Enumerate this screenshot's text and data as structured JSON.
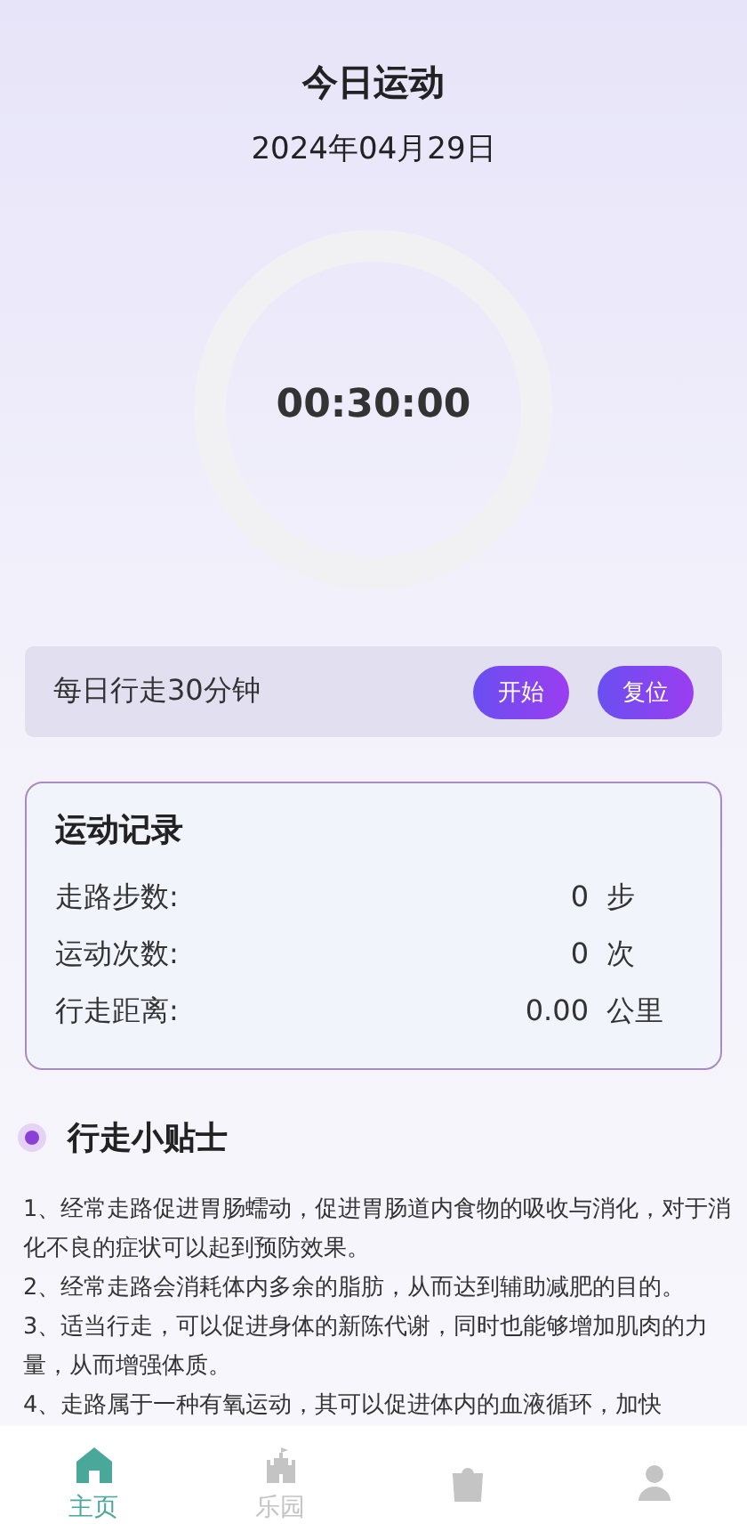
{
  "header": {
    "title": "今日运动",
    "date": "2024年04月29日"
  },
  "timer": {
    "time": "00:30:00"
  },
  "task": {
    "label": "每日行走30分钟",
    "buttons": [
      "开始",
      "复位"
    ]
  },
  "record": {
    "title": "运动记录",
    "rows": [
      {
        "label": "走路步数:",
        "value": "0",
        "unit": "步"
      },
      {
        "label": "运动次数:",
        "value": "0",
        "unit": "次"
      },
      {
        "label": "行走距离:",
        "value": "0.00",
        "unit": "公里"
      }
    ]
  },
  "tips": {
    "title": "行走小贴士",
    "items": [
      "1、经常走路促进胃肠蠕动，促进胃肠道内食物的吸收与消化，对于消化不良的症状可以起到预防效果。",
      "2、经常走路会消耗体内多余的脂肪，从而达到辅助减肥的目的。",
      "3、适当行走，可以促进身体的新陈代谢，同时也能够增加肌肉的力量，从而增强体质。",
      "4、走路属于一种有氧运动，其可以促进体内的血液循环，加快"
    ]
  },
  "tabbar": [
    {
      "kind": "home",
      "label": "主页",
      "selected": true
    },
    {
      "kind": "castle",
      "label": "乐园",
      "selected": false
    },
    {
      "kind": "bag",
      "selected": false
    },
    {
      "kind": "person",
      "selected": false
    }
  ]
}
